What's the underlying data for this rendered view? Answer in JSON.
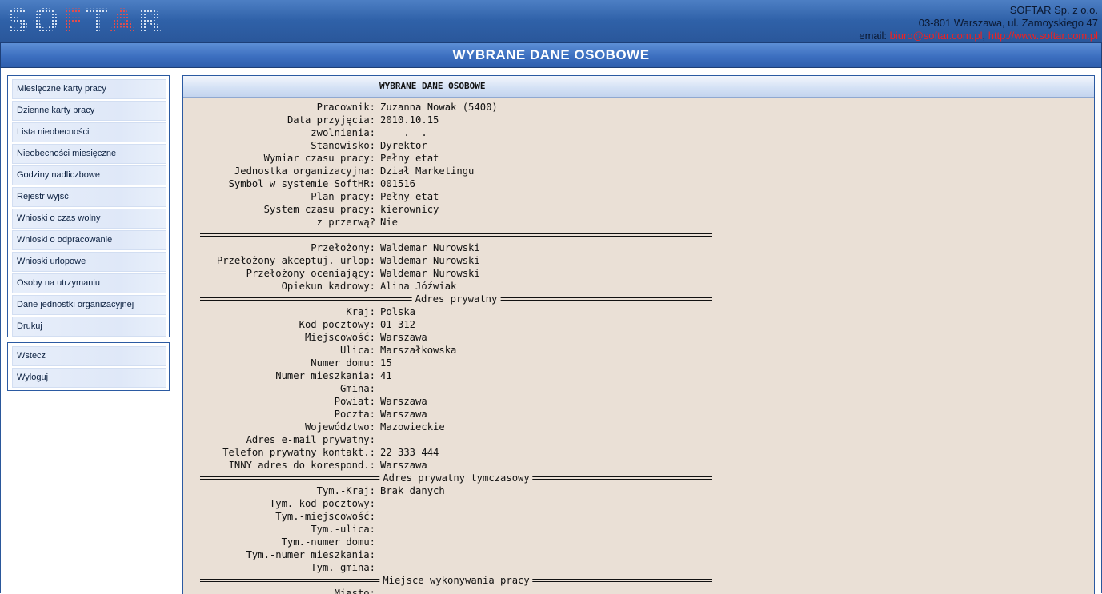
{
  "header": {
    "logo_text": "SOFTAR",
    "company_name": "SOFTAR Sp. z o.o.",
    "address": "03-801 Warszawa, ul. Zamoyskiego 47",
    "email_label": "email:",
    "email": "biuro@softar.com.pl",
    "website": "http://www.softar.com.pl"
  },
  "page_title": "WYBRANE DANE OSOBOWE",
  "menu": {
    "items": [
      {
        "label": "Miesięczne karty pracy"
      },
      {
        "label": "Dzienne karty pracy"
      },
      {
        "label": "Lista nieobecności"
      },
      {
        "label": "Nieobecności miesięczne"
      },
      {
        "label": "Godziny nadliczbowe"
      },
      {
        "label": "Rejestr wyjść"
      },
      {
        "label": "Wnioski o czas wolny"
      },
      {
        "label": "Wnioski o odpracowanie"
      },
      {
        "label": "Wnioski urlopowe"
      },
      {
        "label": "Osoby na utrzymaniu"
      },
      {
        "label": "Dane jednostki organizacyjnej"
      },
      {
        "label": "Drukuj"
      }
    ],
    "secondary": [
      {
        "label": "Wstecz"
      },
      {
        "label": "Wyloguj"
      }
    ]
  },
  "panel": {
    "title": "WYBRANE DANE OSOBOWE",
    "lines": [
      {
        "label": "Pracownik:",
        "value": "Zuzanna Nowak (5400)"
      },
      {
        "label": "Data przyjęcia:",
        "value": "2010.10.15"
      },
      {
        "label": "zwolnienia:",
        "value": "    .  ."
      },
      {
        "label": "Stanowisko:",
        "value": "Dyrektor"
      },
      {
        "label": "Wymiar czasu pracy:",
        "value": "Pełny etat"
      },
      {
        "label": "Jednostka organizacyjna:",
        "value": "Dział Marketingu"
      },
      {
        "label": "Symbol w systemie SoftHR:",
        "value": "001516"
      },
      {
        "label": "Plan pracy:",
        "value": "Pełny etat"
      },
      {
        "label": "System czasu pracy:",
        "value": "kierownicy"
      },
      {
        "label": "z przerwą?",
        "value": "Nie"
      },
      {
        "separator": ""
      },
      {
        "label": "Przełożony:",
        "value": "Waldemar Nurowski"
      },
      {
        "label": "Przełożony akceptuj. urlop:",
        "value": "Waldemar Nurowski"
      },
      {
        "label": "Przełożony oceniający:",
        "value": "Waldemar Nurowski"
      },
      {
        "label": "Opiekun kadrowy:",
        "value": "Alina Jóźwiak"
      },
      {
        "separator": "Adres prywatny"
      },
      {
        "label": "Kraj:",
        "value": "Polska"
      },
      {
        "label": "Kod pocztowy:",
        "value": "01-312"
      },
      {
        "label": "Miejscowość:",
        "value": "Warszawa"
      },
      {
        "label": "Ulica:",
        "value": "Marszałkowska"
      },
      {
        "label": "Numer domu:",
        "value": "15"
      },
      {
        "label": "Numer mieszkania:",
        "value": "41"
      },
      {
        "label": "Gmina:",
        "value": ""
      },
      {
        "label": "Powiat:",
        "value": "Warszawa"
      },
      {
        "label": "Poczta:",
        "value": "Warszawa"
      },
      {
        "label": "Województwo:",
        "value": "Mazowieckie"
      },
      {
        "label": "Adres e-mail prywatny:",
        "value": ""
      },
      {
        "label": "Telefon prywatny kontakt.:",
        "value": "22 333 444"
      },
      {
        "label": "INNY adres do korespond.:",
        "value": "Warszawa"
      },
      {
        "separator": "Adres prywatny tymczasowy"
      },
      {
        "label": "Tym.-Kraj:",
        "value": "Brak danych"
      },
      {
        "label": "Tym.-kod pocztowy:",
        "value": "  -"
      },
      {
        "label": "Tym.-miejscowość:",
        "value": ""
      },
      {
        "label": "Tym.-ulica:",
        "value": ""
      },
      {
        "label": "Tym.-numer domu:",
        "value": ""
      },
      {
        "label": "Tym.-numer mieszkania:",
        "value": ""
      },
      {
        "label": "Tym.-gmina:",
        "value": ""
      },
      {
        "separator": "Miejsce wykonywania pracy"
      },
      {
        "label": "Miasto:",
        "value": ""
      }
    ]
  }
}
